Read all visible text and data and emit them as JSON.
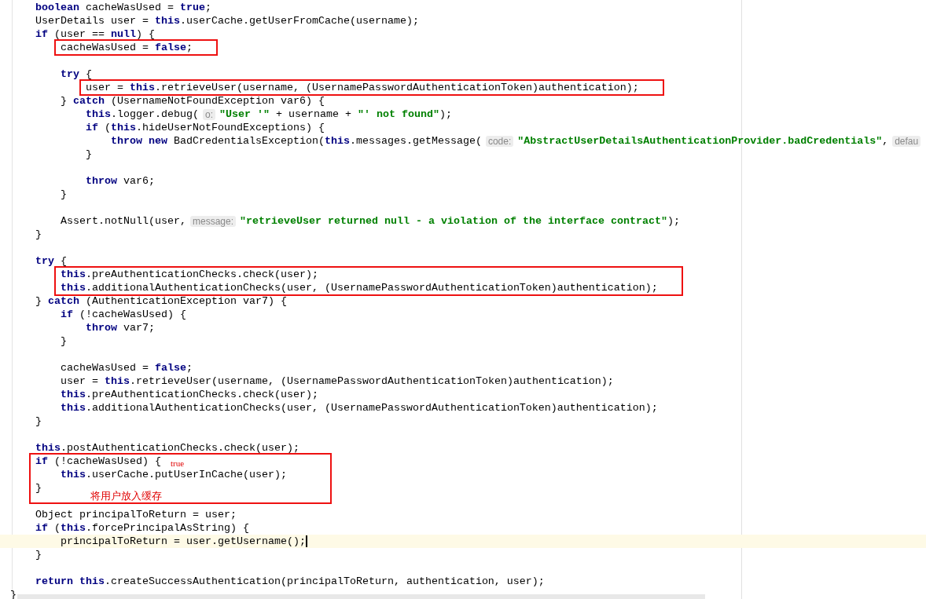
{
  "editor": {
    "method_body": [
      {
        "kind": "code",
        "current": false,
        "tokens": [
          {
            "kind": "keyword",
            "text": "boolean"
          },
          {
            "kind": "plain",
            "text": " cacheWasUsed = "
          },
          {
            "kind": "keyword",
            "text": "true"
          },
          {
            "kind": "plain",
            "text": ";"
          }
        ]
      },
      {
        "kind": "code",
        "current": false,
        "tokens": [
          {
            "kind": "plain",
            "text": "UserDetails user = "
          },
          {
            "kind": "keyword",
            "text": "this"
          },
          {
            "kind": "plain",
            "text": ".userCache.getUserFromCache(username);"
          }
        ]
      },
      {
        "kind": "code",
        "current": false,
        "tokens": [
          {
            "kind": "keyword",
            "text": "if"
          },
          {
            "kind": "plain",
            "text": " (user == "
          },
          {
            "kind": "keyword",
            "text": "null"
          },
          {
            "kind": "plain",
            "text": ") {"
          }
        ],
        "children": [
          {
            "kind": "box",
            "lines": [
              {
                "kind": "code",
                "current": false,
                "tokens": [
                  {
                    "kind": "plain",
                    "text": "cacheWasUsed = "
                  },
                  {
                    "kind": "keyword",
                    "text": "false"
                  },
                  {
                    "kind": "plain",
                    "text": ";"
                  }
                ]
              }
            ]
          },
          {
            "kind": "blank"
          },
          {
            "kind": "code",
            "current": false,
            "tokens": [
              {
                "kind": "keyword",
                "text": "try"
              },
              {
                "kind": "plain",
                "text": " {"
              }
            ],
            "children": [
              {
                "kind": "box",
                "lines": [
                  {
                    "kind": "code",
                    "current": false,
                    "tokens": [
                      {
                        "kind": "plain",
                        "text": "user = "
                      },
                      {
                        "kind": "keyword",
                        "text": "this"
                      },
                      {
                        "kind": "plain",
                        "text": ".retrieveUser(username, (UsernamePasswordAuthenticationToken)authentication);"
                      }
                    ]
                  }
                ]
              }
            ]
          },
          {
            "kind": "code",
            "current": false,
            "tokens": [
              {
                "kind": "plain",
                "text": "} "
              },
              {
                "kind": "keyword",
                "text": "catch"
              },
              {
                "kind": "plain",
                "text": " (UsernameNotFoundException var6) {"
              }
            ],
            "children": [
              {
                "kind": "code",
                "current": false,
                "tokens": [
                  {
                    "kind": "keyword",
                    "text": "this"
                  },
                  {
                    "kind": "plain",
                    "text": ".logger.debug("
                  },
                  {
                    "kind": "hint",
                    "text": "o:"
                  },
                  {
                    "kind": "string",
                    "text": "\"User '\""
                  },
                  {
                    "kind": "plain",
                    "text": " + username + "
                  },
                  {
                    "kind": "string",
                    "text": "\"' not found\""
                  },
                  {
                    "kind": "plain",
                    "text": ");"
                  }
                ]
              },
              {
                "kind": "code",
                "current": false,
                "tokens": [
                  {
                    "kind": "keyword",
                    "text": "if"
                  },
                  {
                    "kind": "plain",
                    "text": " ("
                  },
                  {
                    "kind": "keyword",
                    "text": "this"
                  },
                  {
                    "kind": "plain",
                    "text": ".hideUserNotFoundExceptions) {"
                  }
                ],
                "children": [
                  {
                    "kind": "code",
                    "current": false,
                    "tokens": [
                      {
                        "kind": "keyword",
                        "text": "throw new"
                      },
                      {
                        "kind": "plain",
                        "text": " BadCredentialsException("
                      },
                      {
                        "kind": "keyword",
                        "text": "this"
                      },
                      {
                        "kind": "plain",
                        "text": ".messages.getMessage("
                      },
                      {
                        "kind": "hint",
                        "text": "code:"
                      },
                      {
                        "kind": "string",
                        "text": "\"AbstractUserDetailsAuthenticationProvider.badCredentials\""
                      },
                      {
                        "kind": "plain",
                        "text": ","
                      },
                      {
                        "kind": "hint",
                        "text": "defau"
                      }
                    ]
                  }
                ]
              },
              {
                "kind": "code",
                "current": false,
                "tokens": [
                  {
                    "kind": "plain",
                    "text": "}"
                  }
                ]
              },
              {
                "kind": "blank"
              },
              {
                "kind": "code",
                "current": false,
                "tokens": [
                  {
                    "kind": "keyword",
                    "text": "throw"
                  },
                  {
                    "kind": "plain",
                    "text": " var6;"
                  }
                ]
              }
            ]
          },
          {
            "kind": "code",
            "current": false,
            "tokens": [
              {
                "kind": "plain",
                "text": "}"
              }
            ]
          },
          {
            "kind": "blank"
          },
          {
            "kind": "code",
            "current": false,
            "tokens": [
              {
                "kind": "plain",
                "text": "Assert.notNull(user,"
              },
              {
                "kind": "hint",
                "text": "message:"
              },
              {
                "kind": "string",
                "text": "\"retrieveUser returned null - a violation of the interface contract\""
              },
              {
                "kind": "plain",
                "text": ");"
              }
            ]
          }
        ]
      },
      {
        "kind": "code",
        "current": false,
        "tokens": [
          {
            "kind": "plain",
            "text": "}"
          }
        ]
      },
      {
        "kind": "blank"
      },
      {
        "kind": "code",
        "current": false,
        "tokens": [
          {
            "kind": "keyword",
            "text": "try"
          },
          {
            "kind": "plain",
            "text": " {"
          }
        ],
        "children": [
          {
            "kind": "box",
            "lines": [
              {
                "kind": "code",
                "current": false,
                "tokens": [
                  {
                    "kind": "keyword",
                    "text": "this"
                  },
                  {
                    "kind": "plain",
                    "text": ".preAuthenticationChecks.check(user);"
                  }
                ]
              },
              {
                "kind": "code",
                "current": false,
                "tokens": [
                  {
                    "kind": "keyword",
                    "text": "this"
                  },
                  {
                    "kind": "plain",
                    "text": ".additionalAuthenticationChecks(user, (UsernamePasswordAuthenticationToken)authentication);"
                  }
                ]
              }
            ]
          }
        ]
      },
      {
        "kind": "code",
        "current": false,
        "tokens": [
          {
            "kind": "plain",
            "text": "} "
          },
          {
            "kind": "keyword",
            "text": "catch"
          },
          {
            "kind": "plain",
            "text": " (AuthenticationException var7) {"
          }
        ],
        "children": [
          {
            "kind": "code",
            "current": false,
            "tokens": [
              {
                "kind": "keyword",
                "text": "if"
              },
              {
                "kind": "plain",
                "text": " (!cacheWasUsed) {"
              }
            ],
            "children": [
              {
                "kind": "code",
                "current": false,
                "tokens": [
                  {
                    "kind": "keyword",
                    "text": "throw"
                  },
                  {
                    "kind": "plain",
                    "text": " var7;"
                  }
                ]
              }
            ]
          },
          {
            "kind": "code",
            "current": false,
            "tokens": [
              {
                "kind": "plain",
                "text": "}"
              }
            ]
          },
          {
            "kind": "blank"
          },
          {
            "kind": "code",
            "current": false,
            "tokens": [
              {
                "kind": "plain",
                "text": "cacheWasUsed = "
              },
              {
                "kind": "keyword",
                "text": "false"
              },
              {
                "kind": "plain",
                "text": ";"
              }
            ]
          },
          {
            "kind": "code",
            "current": false,
            "tokens": [
              {
                "kind": "plain",
                "text": "user = "
              },
              {
                "kind": "keyword",
                "text": "this"
              },
              {
                "kind": "plain",
                "text": ".retrieveUser(username, (UsernamePasswordAuthenticationToken)authentication);"
              }
            ]
          },
          {
            "kind": "code",
            "current": false,
            "tokens": [
              {
                "kind": "keyword",
                "text": "this"
              },
              {
                "kind": "plain",
                "text": ".preAuthenticationChecks.check(user);"
              }
            ]
          },
          {
            "kind": "code",
            "current": false,
            "tokens": [
              {
                "kind": "keyword",
                "text": "this"
              },
              {
                "kind": "plain",
                "text": ".additionalAuthenticationChecks(user, (UsernamePasswordAuthenticationToken)authentication);"
              }
            ]
          }
        ]
      },
      {
        "kind": "code",
        "current": false,
        "tokens": [
          {
            "kind": "plain",
            "text": "}"
          }
        ]
      },
      {
        "kind": "blank"
      },
      {
        "kind": "code",
        "current": false,
        "tokens": [
          {
            "kind": "keyword",
            "text": "this"
          },
          {
            "kind": "plain",
            "text": ".postAuthenticationChecks.check(user);"
          }
        ]
      },
      {
        "kind": "box",
        "note": "将用户放入缓存",
        "lines": [
          {
            "kind": "code",
            "current": false,
            "note": "true",
            "tokens": [
              {
                "kind": "keyword",
                "text": "if"
              },
              {
                "kind": "plain",
                "text": " (!cacheWasUsed) {"
              }
            ],
            "children": [
              {
                "kind": "code",
                "current": false,
                "tokens": [
                  {
                    "kind": "keyword",
                    "text": "this"
                  },
                  {
                    "kind": "plain",
                    "text": ".userCache.putUserInCache(user);"
                  }
                ]
              }
            ]
          },
          {
            "kind": "code",
            "current": false,
            "tokens": [
              {
                "kind": "plain",
                "text": "}"
              }
            ]
          }
        ]
      },
      {
        "kind": "code",
        "current": false,
        "tokens": [
          {
            "kind": "plain",
            "text": "Object principalToReturn = user;"
          }
        ]
      },
      {
        "kind": "code",
        "current": false,
        "tokens": [
          {
            "kind": "keyword",
            "text": "if"
          },
          {
            "kind": "plain",
            "text": " ("
          },
          {
            "kind": "keyword",
            "text": "this"
          },
          {
            "kind": "plain",
            "text": ".forcePrincipalAsString) {"
          }
        ],
        "children": [
          {
            "kind": "code",
            "current": true,
            "tokens": [
              {
                "kind": "plain",
                "text": "principalToReturn = user.getUsername();"
              }
            ]
          }
        ]
      },
      {
        "kind": "code",
        "current": false,
        "tokens": [
          {
            "kind": "plain",
            "text": "}"
          }
        ]
      },
      {
        "kind": "blank"
      },
      {
        "kind": "code",
        "current": false,
        "tokens": [
          {
            "kind": "keyword",
            "text": "return this"
          },
          {
            "kind": "plain",
            "text": ".createSuccessAuthentication(principalToReturn, authentication, user);"
          }
        ]
      }
    ],
    "closing_lines": [
      {
        "kind": "code",
        "current": false,
        "tokens": [
          {
            "kind": "plain",
            "text": "}"
          }
        ]
      }
    ]
  }
}
